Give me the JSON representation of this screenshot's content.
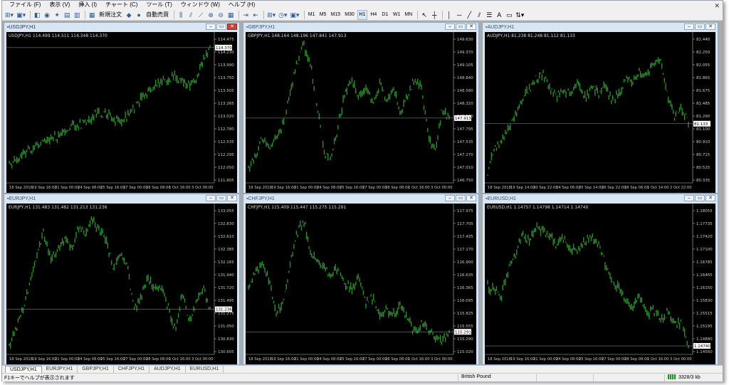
{
  "menu": [
    "ファイル (F)",
    "表示 (V)",
    "挿入 (I)",
    "チャート (C)",
    "ツール (T)",
    "ウィンドウ (W)",
    "ヘルプ (H)"
  ],
  "toolbar": {
    "new_order_label": "新規注文",
    "auto_trading_label": "自動売買",
    "timeframes": [
      "M1",
      "M5",
      "M15",
      "M30",
      "H1",
      "H4",
      "D1",
      "W1",
      "MN"
    ],
    "active_timeframe": "H1"
  },
  "charts": [
    {
      "title": "USDJPY,H1",
      "ohlc": "USDJPY,H1  114.499 114.511 114.348 114.370",
      "price_labels": [
        "114.475",
        "114.230",
        "113.990",
        "113.750",
        "113.505",
        "113.265",
        "113.020",
        "112.780",
        "112.535",
        "112.295",
        "112.050",
        "111.805"
      ],
      "current_price": "114.370",
      "date_labels": [
        "18 Sep 2018",
        "19 Sep 16:00",
        "21 Sep 00:00",
        "24 Sep 08:00",
        "25 Sep 16:00",
        "27 Sep 00:00",
        "28 Sep 08:00",
        "1 Oct 16:00",
        "3 Oct 00:00"
      ],
      "series": [
        0.12,
        0.14,
        0.2,
        0.22,
        0.24,
        0.28,
        0.3,
        0.3,
        0.34,
        0.4,
        0.38,
        0.42,
        0.45,
        0.48,
        0.46,
        0.44,
        0.42,
        0.45,
        0.52,
        0.58,
        0.62,
        0.66,
        0.7,
        0.72,
        0.74,
        0.7,
        0.68,
        0.72,
        0.84,
        0.94
      ],
      "active": true
    },
    {
      "title": "GBPJPY,H1",
      "ohlc": "GBPJPY,H1  148.164 148.196 147.841 147.913",
      "price_labels": [
        "149.630",
        "149.370",
        "149.105",
        "148.840",
        "148.580",
        "148.320",
        "148.060",
        "147.795",
        "147.535",
        "147.270",
        "147.010",
        "146.750"
      ],
      "current_price": "147.913",
      "date_labels": [
        "18 Sep 2018",
        "19 Sep 16:00",
        "21 Sep 00:00",
        "24 Sep 08:00",
        "25 Sep 16:00",
        "27 Sep 00:00",
        "28 Sep 08:00",
        "1 Oct 16:00",
        "3 Oct 00:00"
      ],
      "series": [
        0.08,
        0.16,
        0.3,
        0.24,
        0.3,
        0.4,
        0.6,
        0.84,
        0.96,
        0.8,
        0.5,
        0.18,
        0.16,
        0.4,
        0.62,
        0.7,
        0.58,
        0.66,
        0.52,
        0.7,
        0.56,
        0.64,
        0.48,
        0.6,
        0.72,
        0.66,
        0.3,
        0.2,
        0.5,
        0.44
      ],
      "active": false
    },
    {
      "title": "AUDJPY,H1",
      "ohlc": "AUDJPY,H1  81.238 81.248 81.112 81.133",
      "price_labels": [
        "82.440",
        "82.250",
        "82.055",
        "81.865",
        "81.675",
        "81.485",
        "81.290",
        "81.100",
        "80.910",
        "80.715",
        "80.525",
        "80.335"
      ],
      "current_price": "81.133",
      "date_labels": [
        "18 Sep 2018",
        "19 Sep 14:00",
        "20 Sep 22:00",
        "24 Sep 06:00",
        "25 Sep 14:00",
        "26 Sep 22:00",
        "28 Sep 06:00",
        "1 Oct 14:00",
        "2 Oct 22:00"
      ],
      "series": [
        0.06,
        0.22,
        0.28,
        0.36,
        0.46,
        0.58,
        0.64,
        0.72,
        0.76,
        0.66,
        0.6,
        0.64,
        0.62,
        0.7,
        0.58,
        0.66,
        0.62,
        0.68,
        0.55,
        0.62,
        0.72,
        0.7,
        0.78,
        0.74,
        0.84,
        0.86,
        0.6,
        0.44,
        0.52,
        0.4
      ],
      "active": false
    },
    {
      "title": "EURJPY,H1",
      "ohlc": "EURJPY,H1  131.483 131.482 131.213 131.236",
      "price_labels": [
        "133.055",
        "132.830",
        "132.610",
        "132.385",
        "132.165",
        "131.940",
        "131.720",
        "131.495",
        "131.275",
        "131.050",
        "130.830",
        "130.605"
      ],
      "current_price": "131.236",
      "date_labels": [
        "18 Sep 2018",
        "19 Sep 16:00",
        "21 Sep 00:00",
        "24 Sep 08:00",
        "25 Sep 16:00",
        "27 Sep 00:00",
        "28 Sep 08:00",
        "1 Oct 16:00",
        "3 Oct 00:00"
      ],
      "series": [
        0.05,
        0.16,
        0.3,
        0.48,
        0.7,
        0.84,
        0.66,
        0.7,
        0.8,
        0.72,
        0.88,
        0.82,
        0.94,
        0.86,
        0.8,
        0.58,
        0.7,
        0.62,
        0.3,
        0.38,
        0.52,
        0.44,
        0.46,
        0.3,
        0.16,
        0.42,
        0.22,
        0.34,
        0.46,
        0.3
      ],
      "active": false
    },
    {
      "title": "CHFJPY,H1",
      "ohlc": "CHFJPY,H1  115.409 115.447 115.275 115.291",
      "price_labels": [
        "117.975",
        "117.705",
        "117.435",
        "117.170",
        "116.900",
        "116.635",
        "116.365",
        "116.095",
        "115.825",
        "115.555",
        "115.290",
        "115.020"
      ],
      "current_price": "115.291",
      "date_labels": [
        "18 Sep 2018",
        "19 Sep 16:00",
        "21 Sep 00:00",
        "24 Sep 08:00",
        "25 Sep 16:00",
        "27 Sep 00:00",
        "28 Sep 08:00",
        "1 Oct 16:00",
        "3 Oct 00:00"
      ],
      "series": [
        0.46,
        0.56,
        0.6,
        0.5,
        0.28,
        0.36,
        0.62,
        0.84,
        0.94,
        0.7,
        0.66,
        0.58,
        0.54,
        0.6,
        0.48,
        0.44,
        0.52,
        0.34,
        0.38,
        0.24,
        0.3,
        0.26,
        0.32,
        0.22,
        0.14,
        0.2,
        0.16,
        0.1,
        0.08,
        0.14
      ],
      "active": false
    },
    {
      "title": "EURUSD,H1",
      "ohlc": "EURUSD,H1  1.14757 1.14798 1.14714 1.14740",
      "price_labels": [
        "1.18055",
        "1.17735",
        "1.17420",
        "1.17100",
        "1.16785",
        "1.16465",
        "1.16150",
        "1.15830",
        "1.15515",
        "1.15195",
        "1.14880",
        "1.14560"
      ],
      "current_price": "1.14740",
      "date_labels": [
        "18 Sep 2018",
        "19 Sep 16:00",
        "21 Sep 00:00",
        "24 Sep 08:00",
        "25 Sep 16:00",
        "27 Sep 00:00",
        "28 Sep 08:00",
        "1 Oct 16:00",
        "3 Oct 00:00"
      ],
      "series": [
        0.46,
        0.44,
        0.4,
        0.58,
        0.7,
        0.82,
        0.78,
        0.9,
        0.84,
        0.82,
        0.76,
        0.8,
        0.74,
        0.7,
        0.78,
        0.82,
        0.76,
        0.62,
        0.48,
        0.46,
        0.36,
        0.3,
        0.4,
        0.26,
        0.3,
        0.22,
        0.28,
        0.18,
        0.2,
        0.04
      ],
      "active": false
    }
  ],
  "tabs": [
    "USDJPY,H1",
    "EURJPY,H1",
    "GBPJPY,H1",
    "CHFJPY,H1",
    "AUDJPY,H1",
    "EURUSD,H1"
  ],
  "active_tab": "USDJPY,H1",
  "status": {
    "hint": "F1キーでヘルプが表示されます",
    "profile": "British Pound",
    "traffic": "3328/3 kb"
  },
  "colors": {
    "candle_up": "#2e8b2e",
    "background": "#000000",
    "axis_text": "#c8c8c8",
    "grid_line": "#4a4a4a"
  }
}
